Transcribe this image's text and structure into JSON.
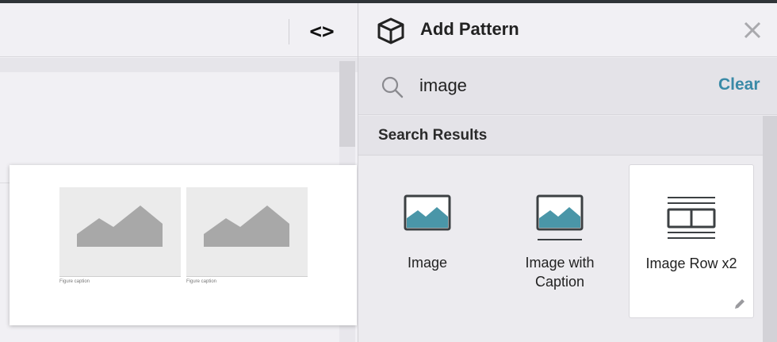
{
  "editor": {
    "code_toggle_label": "<>",
    "preview": {
      "captions": [
        "Figure caption",
        "Figure caption"
      ]
    }
  },
  "panel": {
    "title": "Add Pattern",
    "search": {
      "value": "image",
      "clear_label": "Clear"
    },
    "results_title": "Search Results",
    "results": [
      {
        "label": "Image",
        "icon": "image-icon"
      },
      {
        "label": "Image with Caption",
        "icon": "image-caption-icon"
      },
      {
        "label": "Image Row x2",
        "icon": "image-row-icon",
        "selected": true
      }
    ]
  },
  "colors": {
    "accent": "#3a8aa7",
    "image_fill": "#4a96a8",
    "icon_frame": "#3c4043"
  }
}
